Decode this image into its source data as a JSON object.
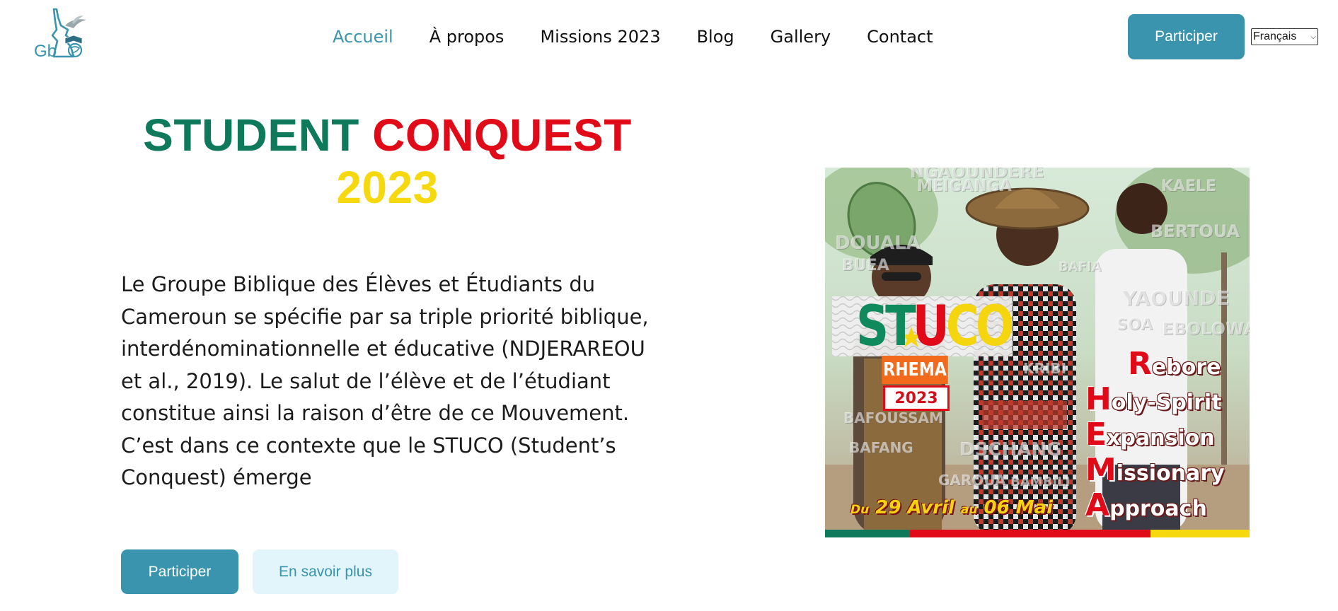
{
  "header": {
    "logo_alt": "GbEEC",
    "nav": [
      {
        "label": "Accueil",
        "active": true
      },
      {
        "label": "À propos",
        "active": false
      },
      {
        "label": "Missions 2023",
        "active": false
      },
      {
        "label": "Blog",
        "active": false
      },
      {
        "label": "Gallery",
        "active": false
      },
      {
        "label": "Contact",
        "active": false
      }
    ],
    "cta_label": "Participer",
    "language": {
      "selected": "Français"
    }
  },
  "hero": {
    "title_part1": "STUDENT",
    "title_part2": "CONQUEST",
    "title_part3": "2023",
    "description": "Le Groupe Biblique des Élèves et Étudiants du Cameroun se spécifie par sa triple priorité biblique, interdénominationnelle et éducative (NDJERAREOU et al., 2019). Le salut de l’élève et de l’étudiant constitue ainsi la raison d’être de ce Mouvement. C’est dans ce contexte que le STUCO (Student’s Conquest) émerge",
    "primary_button": "Participer",
    "secondary_button": "En savoir plus"
  },
  "poster": {
    "brand": {
      "s": "ST",
      "u": "U",
      "co": "CO"
    },
    "rhema": "RHEMA",
    "year": "2023",
    "acrostic": [
      {
        "initial": "R",
        "rest": "ebore"
      },
      {
        "initial": "H",
        "rest": "oly-Spirit"
      },
      {
        "initial": "E",
        "rest": "xpansion"
      },
      {
        "initial": "M",
        "rest": "issionary"
      },
      {
        "initial": "A",
        "rest": "pproach"
      }
    ],
    "date": {
      "du": "Du",
      "start": "29 Avril",
      "au": "au",
      "end": "06 Mai"
    },
    "cities": [
      "NGAOUNDERE",
      "MEIGANGA",
      "KAELE",
      "DOUALA",
      "BERTOUA",
      "BUEA",
      "YAOUNDE",
      "SOA",
      "EBOLOWA",
      "BAFOUSSAM",
      "BAFANG",
      "DSCHANG",
      "BAMBILI",
      "BAFIA",
      "GAROUA",
      "KRIBI"
    ]
  },
  "colors": {
    "accent": "#3a94ae",
    "accent_light": "#e2f5fb",
    "green": "#0e7a5b",
    "red": "#e10a18",
    "yellow": "#f5d90e"
  }
}
